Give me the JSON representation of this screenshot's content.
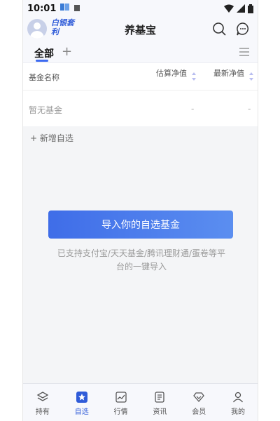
{
  "status_bar": {
    "time": "10:01"
  },
  "header": {
    "brand": "白银套利",
    "title": "养基宝"
  },
  "tabs": {
    "all": "全部",
    "add": "+"
  },
  "table": {
    "col_name": "基金名称",
    "col_estimate": "估算净值",
    "col_latest": "最新净值",
    "empty_name": "暂无基金",
    "empty_estimate": "-",
    "empty_latest": "-"
  },
  "add_favorite": "+ 新增自选",
  "import_button": "导入你的自选基金",
  "support_text": "已支持支付宝/天天基金/腾讯理财通/蛋卷等平台的一键导入",
  "nav": [
    {
      "label": "持有",
      "icon": "layers-icon"
    },
    {
      "label": "自选",
      "icon": "star-icon"
    },
    {
      "label": "行情",
      "icon": "chart-icon"
    },
    {
      "label": "资讯",
      "icon": "news-icon"
    },
    {
      "label": "会员",
      "icon": "diamond-icon"
    },
    {
      "label": "我的",
      "icon": "person-icon"
    }
  ],
  "colors": {
    "accent": "#3d6af0",
    "brand": "#2f5bd8",
    "background": "#f4f5f7"
  }
}
